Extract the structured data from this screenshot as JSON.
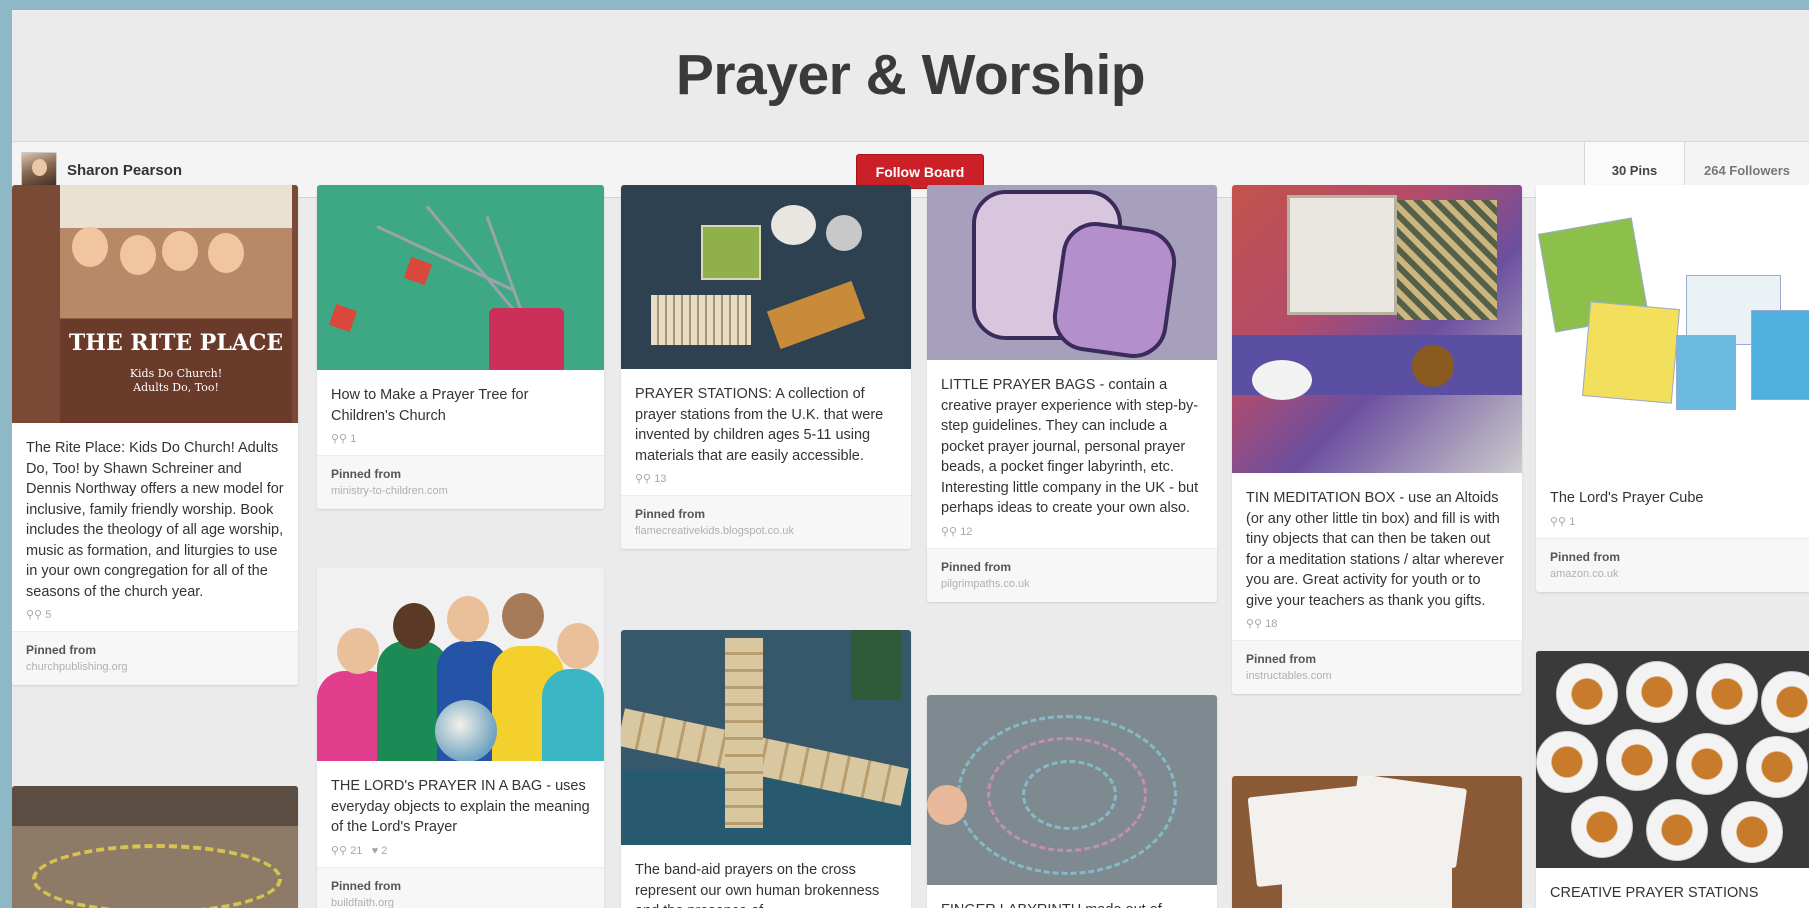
{
  "board": {
    "title": "Prayer & Worship",
    "owner": "Sharon Pearson",
    "follow_label": "Follow Board",
    "pins_count": "30 Pins",
    "followers_count": "264 Followers"
  },
  "pins": {
    "rite": {
      "image_alt": "THE RITE PLACE",
      "image_sub1": "Kids Do Church!",
      "image_sub2": "Adults Do, Too!",
      "description": "The Rite Place: Kids Do Church! Adults Do, Too! by Shawn Schreiner and Dennis Northway offers a new model for inclusive, family friendly worship. Book includes the theology of all age worship, music as formation, and liturgies to use in your own congregation for all of the seasons of the church year.",
      "repins": "5",
      "pinned_label": "Pinned from",
      "source": "churchpublishing.org"
    },
    "tree": {
      "description": "How to Make a Prayer Tree for Children's Church",
      "repins": "1",
      "pinned_label": "Pinned from",
      "source": "ministry-to-children.com"
    },
    "lords_bag": {
      "description": "THE LORD's PRAYER IN A BAG - uses everyday objects to explain the meaning of the Lord's Prayer",
      "repins": "21",
      "likes": "2",
      "pinned_label": "Pinned from",
      "source": "buildfaith.org"
    },
    "stations": {
      "description": "PRAYER STATIONS: A collection of prayer stations from the U.K. that were invented by children ages 5-11 using materials that are easily accessible.",
      "repins": "13",
      "pinned_label": "Pinned from",
      "source": "flamecreativekids.blogspot.co.uk"
    },
    "bandaid": {
      "description": "The band-aid prayers on the cross represent our own human brokenness and the presence of"
    },
    "bags": {
      "description": "LITTLE PRAYER BAGS - contain a creative prayer experience with step-by-step guidelines. They can include a pocket prayer journal, personal prayer beads, a pocket finger labyrinth, etc. Interesting little company in the UK - but perhaps ideas to create your own also.",
      "repins": "12",
      "pinned_label": "Pinned from",
      "source": "pilgrimpaths.co.uk"
    },
    "labyrinth": {
      "description": "FINGER LABYRINTH made out of"
    },
    "tin": {
      "description": "TIN MEDITATION BOX - use an Altoids (or any other little tin box) and fill is with tiny objects that can then be taken out for a meditation stations / altar wherever you are. Great activity for youth or to give your teachers as thank you gifts.",
      "repins": "18",
      "pinned_label": "Pinned from",
      "source": "instructables.com"
    },
    "cube": {
      "description": "The Lord's Prayer Cube",
      "repins": "1",
      "pinned_label": "Pinned from",
      "source": "amazon.co.uk"
    },
    "creative": {
      "description": "CREATIVE PRAYER STATIONS"
    }
  },
  "icons": {
    "repin": "pin-icon",
    "like": "heart-icon"
  }
}
